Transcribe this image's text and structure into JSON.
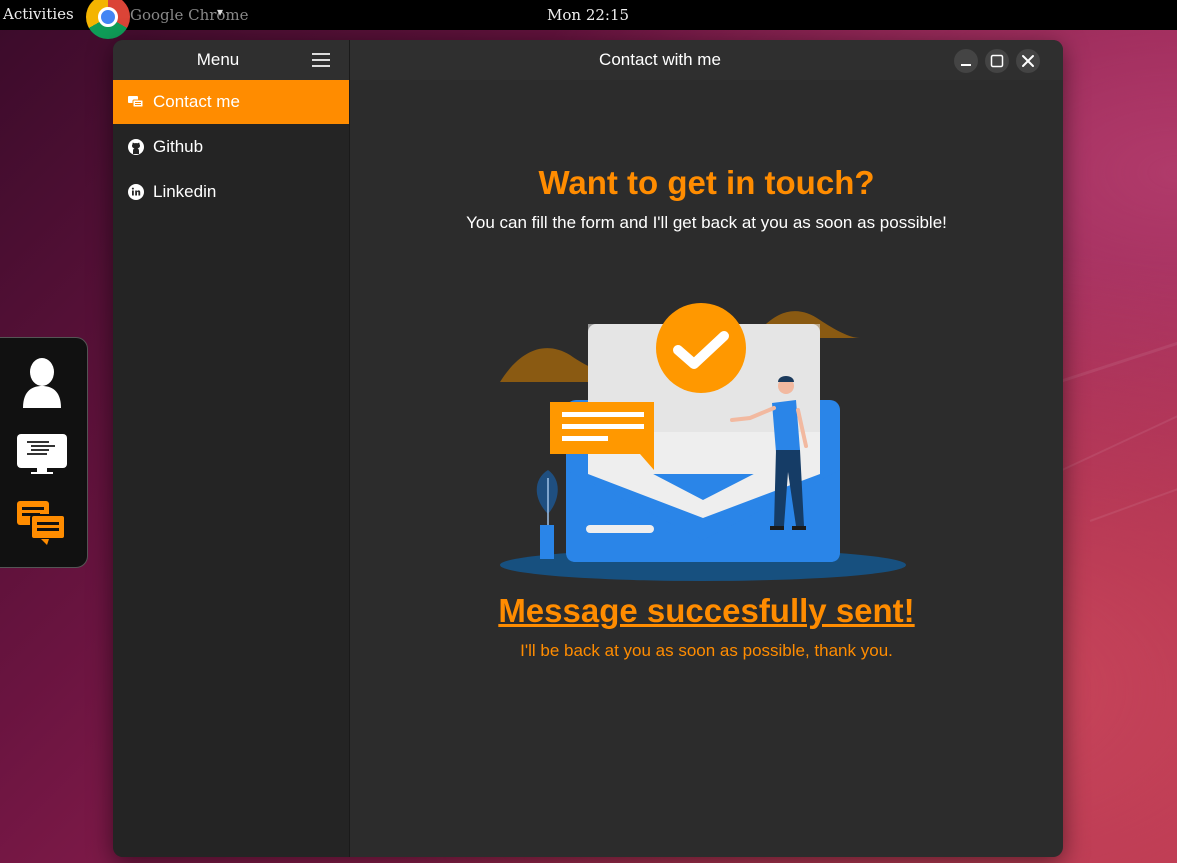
{
  "topbar": {
    "activities": "Activities",
    "app_name": "Google Chrome",
    "clock": "Mon 22:15"
  },
  "dock": {
    "items": [
      {
        "icon": "user-icon"
      },
      {
        "icon": "monitor-terminal-icon"
      },
      {
        "icon": "chat-bubbles-icon"
      }
    ]
  },
  "window": {
    "sidebar": {
      "title": "Menu",
      "items": [
        {
          "label": "Contact me",
          "icon": "chat-icon",
          "active": true
        },
        {
          "label": "Github",
          "icon": "github-icon",
          "active": false
        },
        {
          "label": "Linkedin",
          "icon": "linkedin-icon",
          "active": false
        }
      ]
    },
    "title": "Contact with me",
    "content": {
      "heading": "Want to get in touch?",
      "subheading": "You can fill the form and I'll get back at you as soon as possible!",
      "success_title": "Message succesfully sent!",
      "success_text": "I'll be back at you as soon as possible, thank you."
    }
  },
  "colors": {
    "accent": "#ff8c00",
    "window_bg": "#2c2c2c",
    "illustration_blue": "#2a85e8"
  }
}
